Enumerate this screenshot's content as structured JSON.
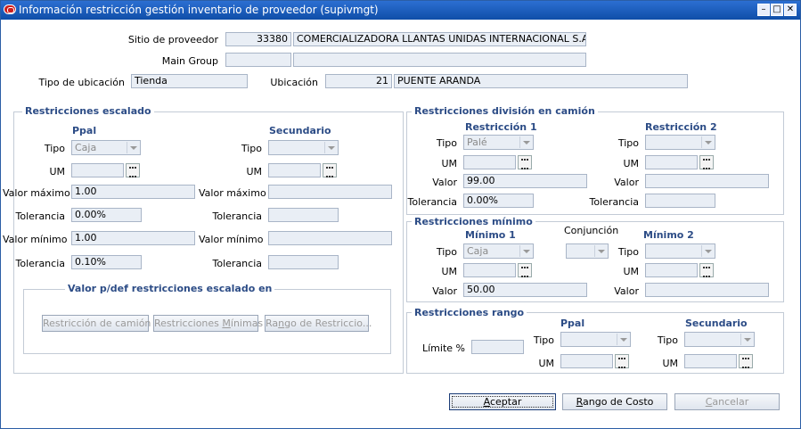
{
  "window": {
    "title": "Información restricción gestión inventario de proveedor (supivmgt)"
  },
  "header": {
    "supplier_site_label": "Sitio de proveedor",
    "supplier_site_id": "33380",
    "supplier_site_name": "COMERCIALIZADORA LLANTAS UNIDAS INTERNACIONAL S.A.S. C",
    "main_group_label": "Main Group",
    "main_group_code": "",
    "main_group_name": "",
    "location_type_label": "Tipo de ubicación",
    "location_type_value": "Tienda",
    "location_label": "Ubicación",
    "location_id": "21",
    "location_name": "PUENTE ARANDA"
  },
  "scaling": {
    "title": "Restricciones escalado",
    "primary_header": "Ppal",
    "secondary_header": "Secundario",
    "type_label": "Tipo",
    "um_label": "UM",
    "max_value_label": "Valor máximo",
    "tolerance_label": "Tolerancia",
    "min_value_label": "Valor mínimo",
    "primary": {
      "type": "Caja",
      "um": "",
      "max_value": "1.00",
      "max_tolerance": "0.00%",
      "min_value": "1.00",
      "min_tolerance": "0.10%"
    },
    "secondary": {
      "type": "",
      "um": "",
      "max_value": "",
      "max_tolerance": "",
      "min_value": "",
      "min_tolerance": ""
    },
    "defaults_title": "Valor p/def restricciones escalado en",
    "btn_truck": "Restricción de camión",
    "btn_min_prefix": "Restricciones ",
    "btn_min_hotkey": "M",
    "btn_min_suffix": "ínimas",
    "btn_range_prefix": "Ra",
    "btn_range_hotkey": "n",
    "btn_range_suffix": "go de Restriccio..."
  },
  "truck": {
    "title": "Restricciones división en camión",
    "r1_header": "Restricción 1",
    "r2_header": "Restricción 2",
    "type_label": "Tipo",
    "um_label": "UM",
    "value_label": "Valor",
    "tolerance_label": "Tolerancia",
    "r1": {
      "type": "Palé",
      "um": "",
      "value": "99.00",
      "tolerance": "0.00%"
    },
    "r2": {
      "type": "",
      "um": "",
      "value": "",
      "tolerance": ""
    }
  },
  "minimum": {
    "title": "Restricciones mínimo",
    "m1_header": "Mínimo 1",
    "conj_header": "Conjunción",
    "m2_header": "Mínimo 2",
    "type_label": "Tipo",
    "um_label": "UM",
    "value_label": "Valor",
    "m1": {
      "type": "Caja",
      "um": "",
      "value": "50.00"
    },
    "conjunction": "",
    "m2": {
      "type": "",
      "um": "",
      "value": ""
    }
  },
  "range": {
    "title": "Restricciones rango",
    "limit_label": "Límite %",
    "limit_value": "",
    "primary_header": "Ppal",
    "secondary_header": "Secundario",
    "type_label": "Tipo",
    "um_label": "UM",
    "primary": {
      "type": "",
      "um": ""
    },
    "secondary": {
      "type": "",
      "um": ""
    }
  },
  "footer": {
    "ok_prefix": "",
    "ok_hotkey": "A",
    "ok_suffix": "ceptar",
    "cost_prefix": "",
    "cost_hotkey": "R",
    "cost_suffix": "ango de Costo",
    "cancel_prefix": "",
    "cancel_hotkey": "C",
    "cancel_suffix": "ancelar"
  },
  "colors": {
    "titlebar": "#1a5cc0",
    "group_title": "#2c4c86",
    "field_bg": "#e9eef5"
  }
}
